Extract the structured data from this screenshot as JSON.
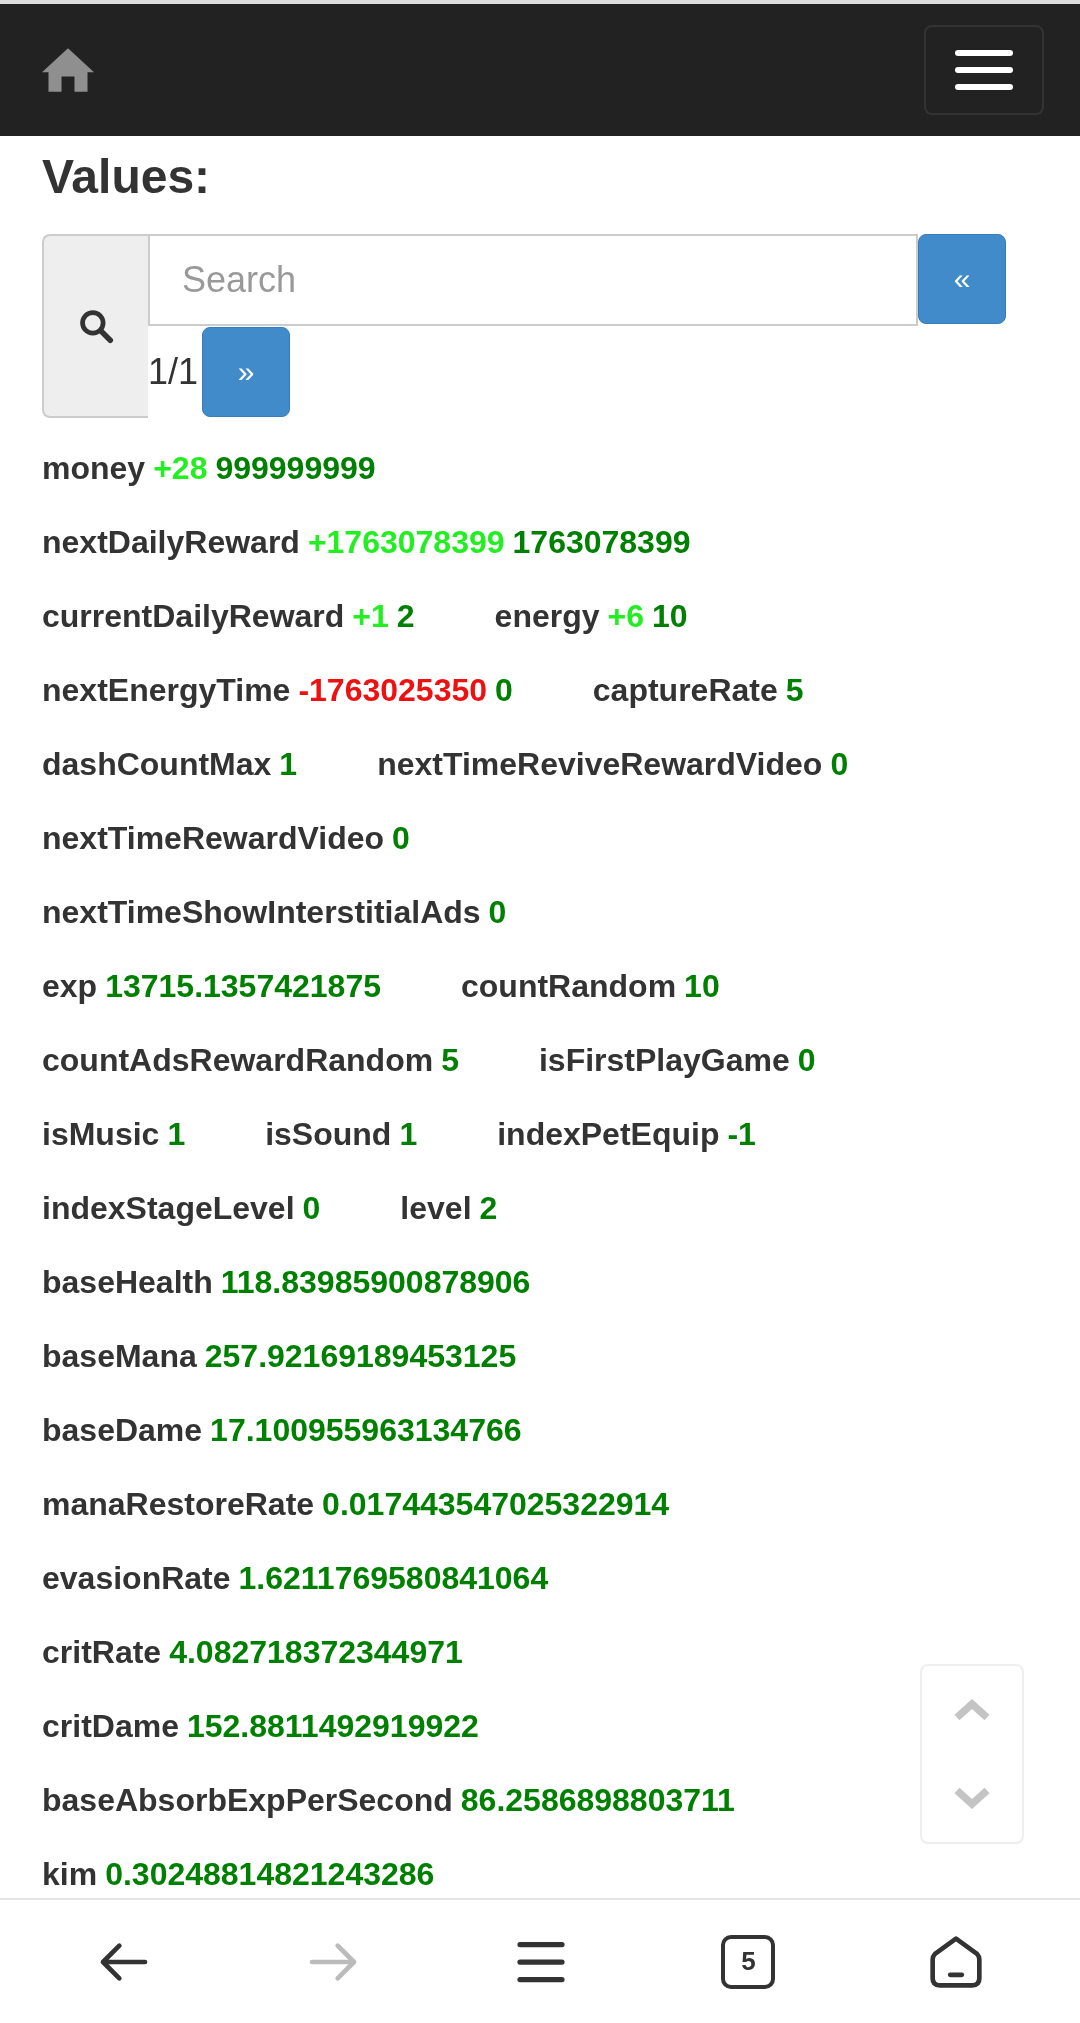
{
  "title": "Values:",
  "search": {
    "placeholder": "Search",
    "page": "1/1",
    "prev": "«",
    "next": "»"
  },
  "rows": [
    [
      {
        "name": "money",
        "delta": "+28",
        "color": "#22ee22",
        "value": "999999999"
      }
    ],
    [
      {
        "name": "nextDailyReward",
        "delta": "+1763078399",
        "color": "#22ee22",
        "value": "1763078399"
      }
    ],
    [
      {
        "name": "currentDailyReward",
        "delta": "+1",
        "color": "#22ee22",
        "value": "2"
      },
      {
        "name": "energy",
        "delta": "+6",
        "color": "#22ee22",
        "value": "10"
      }
    ],
    [
      {
        "name": "nextEnergyTime",
        "delta": "-1763025350",
        "color": "#ee1111",
        "value": "0"
      },
      {
        "name": "captureRate",
        "value": "5"
      }
    ],
    [
      {
        "name": "dashCountMax",
        "value": "1"
      },
      {
        "name": "nextTimeReviveRewardVideo",
        "value": "0"
      }
    ],
    [
      {
        "name": "nextTimeRewardVideo",
        "value": "0"
      }
    ],
    [
      {
        "name": "nextTimeShowInterstitialAds",
        "value": "0"
      }
    ],
    [
      {
        "name": "exp",
        "value": "13715.1357421875"
      },
      {
        "name": "countRandom",
        "value": "10"
      }
    ],
    [
      {
        "name": "countAdsRewardRandom",
        "value": "5"
      },
      {
        "name": "isFirstPlayGame",
        "value": "0"
      }
    ],
    [
      {
        "name": "isMusic",
        "value": "1"
      },
      {
        "name": "isSound",
        "value": "1"
      },
      {
        "name": "indexPetEquip",
        "value": "-1"
      }
    ],
    [
      {
        "name": "indexStageLevel",
        "value": "0"
      },
      {
        "name": "level",
        "value": "2"
      }
    ],
    [
      {
        "name": "baseHealth",
        "value": "118.83985900878906"
      }
    ],
    [
      {
        "name": "baseMana",
        "value": "257.92169189453125"
      }
    ],
    [
      {
        "name": "baseDame",
        "value": "17.100955963134766"
      }
    ],
    [
      {
        "name": "manaRestoreRate",
        "value": "0.017443547025322914"
      }
    ],
    [
      {
        "name": "evasionRate",
        "value": "1.6211769580841064"
      }
    ],
    [
      {
        "name": "critRate",
        "value": "4.082718372344971"
      }
    ],
    [
      {
        "name": "critDame",
        "value": "152.8811492919922"
      }
    ],
    [
      {
        "name": "baseAbsorbExpPerSecond",
        "value": "86.2586898803711"
      }
    ],
    [
      {
        "name": "kim",
        "value": "0.30248814821243286"
      }
    ]
  ],
  "bottom_bar": [
    {
      "kind": "back",
      "disabled": false
    },
    {
      "kind": "forward",
      "disabled": true
    },
    {
      "kind": "menu",
      "disabled": false
    },
    {
      "kind": "tabs",
      "label": "5",
      "disabled": false
    },
    {
      "kind": "home",
      "disabled": false
    }
  ]
}
